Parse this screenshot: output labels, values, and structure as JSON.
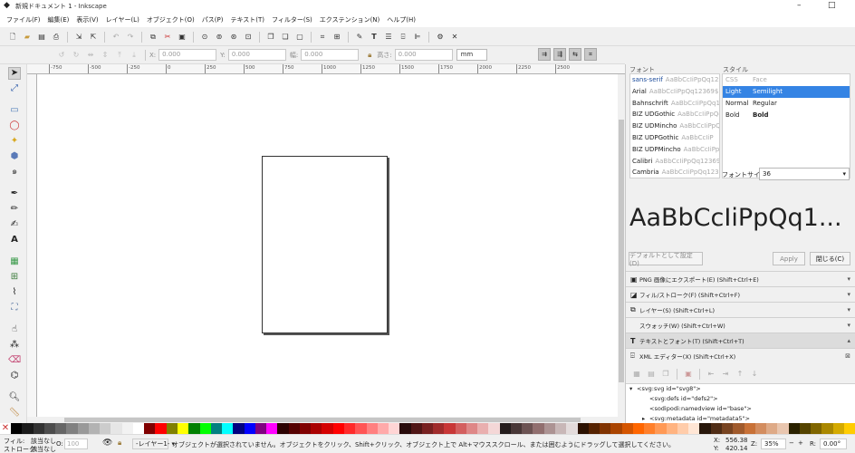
{
  "window": {
    "title": "新規ドキュメント 1 - Inkscape",
    "minimize": "–",
    "maximize": "□"
  },
  "menu": [
    "ファイル(F)",
    "編集(E)",
    "表示(V)",
    "レイヤー(L)",
    "オブジェクト(O)",
    "パス(P)",
    "テキスト(T)",
    "フィルター(S)",
    "エクステンション(N)",
    "ヘルプ(H)"
  ],
  "control": {
    "x_label": "X:",
    "x_value": "0.000",
    "y_label": "Y:",
    "y_value": "0.000",
    "w_label": "幅:",
    "w_value": "0.000",
    "h_label": "高さ:",
    "h_value": "0.000",
    "unit": "mm"
  },
  "ruler_ticks": [
    "-750",
    "-500",
    "-250",
    "0",
    "250",
    "500",
    "750",
    "1000",
    "1250",
    "1500",
    "1750",
    "2000",
    "2250",
    "2500"
  ],
  "font_panel": {
    "font_label": "フォント",
    "style_label": "スタイル",
    "fonts": [
      {
        "name": "sans-serif",
        "sample": "AaBbCcIiPpQq12369$"
      },
      {
        "name": "Arial",
        "sample": "AaBbCcIiPpQq12369$"
      },
      {
        "name": "Bahnschrift",
        "sample": "AaBbCcIiPpQq12369$"
      },
      {
        "name": "BIZ UDGothic",
        "sample": "AaBbCcIiPpQq"
      },
      {
        "name": "BIZ UDMincho",
        "sample": "AaBbCcIiPpQq"
      },
      {
        "name": "BIZ UDPGothic",
        "sample": "AaBbCcIiP"
      },
      {
        "name": "BIZ UDPMincho",
        "sample": "AaBbCcIiPp"
      },
      {
        "name": "Calibri",
        "sample": "AaBbCcIiPpQq12369$"
      },
      {
        "name": "Cambria",
        "sample": "AaBbCcIiPpQq12369$"
      },
      {
        "name": "Candara",
        "sample": "AaBbCcIiPpQq12369$"
      }
    ],
    "styles": [
      {
        "css": "CSS",
        "face": "Face",
        "header": true
      },
      {
        "css": "Light",
        "face": "Semilight",
        "selected": true
      },
      {
        "css": "Normal",
        "face": "Regular"
      },
      {
        "css": "Bold",
        "face": "Bold"
      }
    ],
    "size_label": "フォントサイズ",
    "size_value": "36",
    "preview": "AaBbCcIiPpQq1...",
    "default_btn": "デフォルトとして設定(D)",
    "apply_btn": "Apply",
    "close_btn": "閉じる(C)"
  },
  "docks": [
    {
      "icon": "png-export-icon",
      "glyph": "▣",
      "label": "PNG 画像にエクスポート(E) (Shift+Ctrl+E)",
      "chev": "▾"
    },
    {
      "icon": "fill-stroke-icon",
      "glyph": "◪",
      "label": "フィル/ストローク(F) (Shift+Ctrl+F)",
      "chev": "▾"
    },
    {
      "icon": "layers-icon",
      "glyph": "⧉",
      "label": "レイヤー(S) (Shift+Ctrl+L)",
      "chev": "▾"
    },
    {
      "icon": "swatches-icon",
      "glyph": "",
      "label": "スウォッチ(W) (Shift+Ctrl+W)",
      "chev": "▾"
    },
    {
      "icon": "text-font-icon",
      "glyph": "T",
      "label": "テキストとフォント(T) (Shift+Ctrl+T)",
      "chev": "▴"
    },
    {
      "icon": "xml-editor-icon",
      "glyph": "⌹",
      "label": "XML エディター(X) (Shift+Ctrl+X)",
      "chev": "⊠"
    }
  ],
  "xml_nodes": [
    {
      "text": "<svg:svg id=\"svg8\">",
      "indent": 0,
      "arrow": "▾"
    },
    {
      "text": "<svg:defs id=\"defs2\">",
      "indent": 1,
      "arrow": ""
    },
    {
      "text": "<sodipodi:namedview id=\"base\">",
      "indent": 1,
      "arrow": ""
    },
    {
      "text": "<svg:metadata id=\"metadata5\">",
      "indent": 1,
      "arrow": "▸"
    }
  ],
  "status": {
    "fill_label": "フィル:",
    "fill_value": "該当なし",
    "stroke_label": "ストローク:",
    "stroke_value": "該当なし",
    "opacity_label": "O:",
    "opacity_value": "100",
    "layer": "-レイヤー1-",
    "message": "オブジェクトが選択されていません。オブジェクトをクリック、Shift+クリック、オブジェクト上で Alt+マウススクロール、または囲むようにドラッグして選択してください。",
    "x_label": "X:",
    "x_value": "556.38",
    "y_label": "Y:",
    "y_value": "420.14",
    "zoom_label": "Z:",
    "zoom_value": "35%",
    "rot_label": "R:",
    "rot_value": "0.00°"
  },
  "palette": [
    "#000000",
    "#1a1a1a",
    "#333333",
    "#4d4d4d",
    "#666666",
    "#808080",
    "#999999",
    "#b3b3b3",
    "#cccccc",
    "#e6e6e6",
    "#f2f2f2",
    "#ffffff",
    "#800000",
    "#ff0000",
    "#808000",
    "#ffff00",
    "#008000",
    "#00ff00",
    "#008080",
    "#00ffff",
    "#000080",
    "#0000ff",
    "#800080",
    "#ff00ff",
    "#2b0000",
    "#550000",
    "#800000",
    "#aa0000",
    "#d40000",
    "#ff0000",
    "#ff2a2a",
    "#ff5555",
    "#ff8080",
    "#ffaaaa",
    "#ffd5d5",
    "#280b0b",
    "#501616",
    "#782121",
    "#a02c2c",
    "#c83737",
    "#d35f5f",
    "#de8787",
    "#e9afaf",
    "#f4d7d7",
    "#241c1c",
    "#483737",
    "#6c5353",
    "#916f6f",
    "#ac9393",
    "#c8b7b7",
    "#e3dbdb",
    "#2b1100",
    "#552200",
    "#803300",
    "#aa4400",
    "#d45500",
    "#ff6600",
    "#ff7f2a",
    "#ff9955",
    "#ffb380",
    "#ffccaa",
    "#ffe6d5",
    "#28170b",
    "#502d16",
    "#784421",
    "#a05a2c",
    "#c87137",
    "#d38d5f",
    "#deaa87",
    "#e9c6af",
    "#2b2200",
    "#554400",
    "#806600",
    "#aa8800",
    "#d4aa00",
    "#ffcc00"
  ]
}
